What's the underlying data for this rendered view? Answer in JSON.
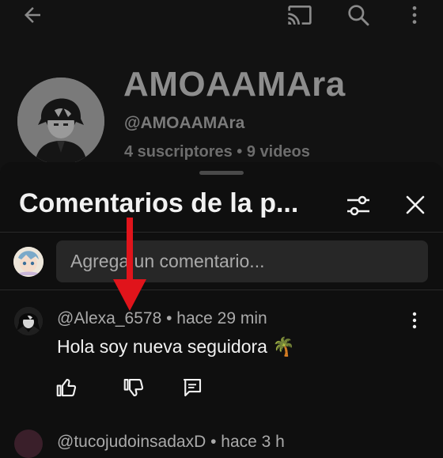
{
  "channel": {
    "name": "AMOAAMAra",
    "handle": "@AMOAAMAra",
    "stats": "4 suscriptores • 9 videos"
  },
  "topbar": {
    "icons": [
      "back-arrow-icon",
      "cast-icon",
      "search-icon",
      "more-vert-icon"
    ]
  },
  "sheet": {
    "title": "Comentarios de la p...",
    "input_placeholder": "Agrega un comentario..."
  },
  "comments": [
    {
      "author": "@Alexa_6578",
      "time": "hace 29 min",
      "meta": "@Alexa_6578 • hace 29 min",
      "text": "Hola soy nueva seguidora 🌴"
    },
    {
      "author": "@tucojudoinsadaxD",
      "time": "hace 3 h",
      "meta": "@tucojudoinsadaxD • hace 3 h"
    }
  ],
  "colors": {
    "background": "#0f0f0f",
    "annotation_arrow": "#e0141b",
    "text_primary": "#f1f1f1",
    "text_secondary": "#aaaaaa"
  }
}
